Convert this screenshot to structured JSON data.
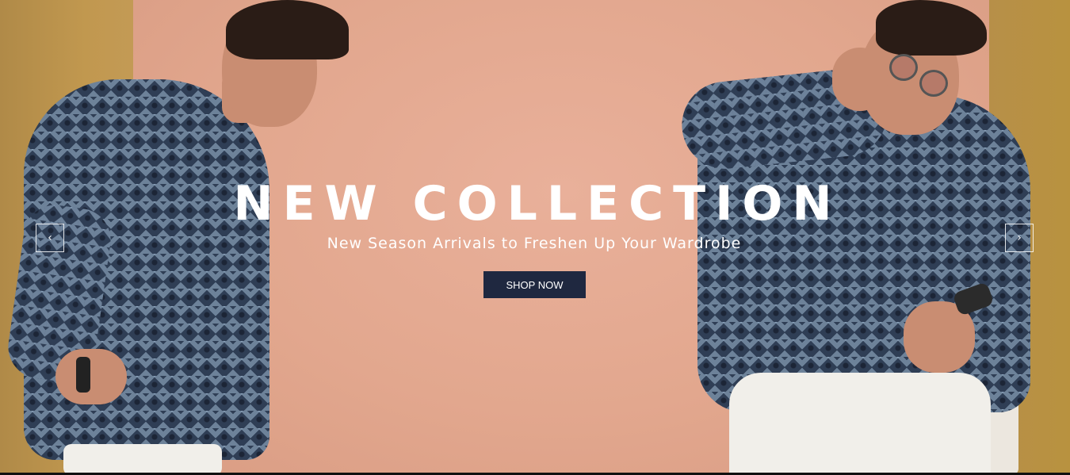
{
  "hero": {
    "title": "NEW COLLECTION",
    "subtitle": "New Season Arrivals to Freshen Up Your Wardrobe",
    "cta_label": "SHOP NOW",
    "colors": {
      "backdrop": "#e6ab92",
      "wall": "#c1984f",
      "button_bg": "#1f2840",
      "text": "#ffffff"
    }
  },
  "carousel": {
    "prev_icon": "chevron-left-icon",
    "next_icon": "chevron-right-icon",
    "prev_glyph": "‹",
    "next_glyph": "›"
  }
}
